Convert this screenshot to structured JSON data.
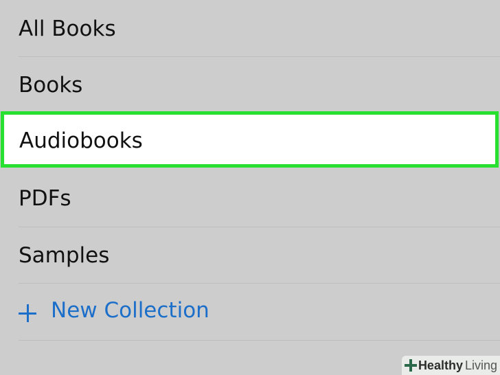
{
  "collections": {
    "items": [
      {
        "label": "All Books"
      },
      {
        "label": "Books"
      },
      {
        "label": "Audiobooks",
        "highlighted": true
      },
      {
        "label": "PDFs"
      },
      {
        "label": "Samples"
      }
    ],
    "new_collection_label": "New Collection",
    "new_collection_icon": "plus-icon"
  },
  "colors": {
    "background": "#cdcdcd",
    "highlight_border": "#27e02f",
    "highlight_fill": "#ffffff",
    "link": "#1b6ec9"
  },
  "watermark": {
    "brand_bold": "Healthy",
    "brand_light": "Living"
  }
}
